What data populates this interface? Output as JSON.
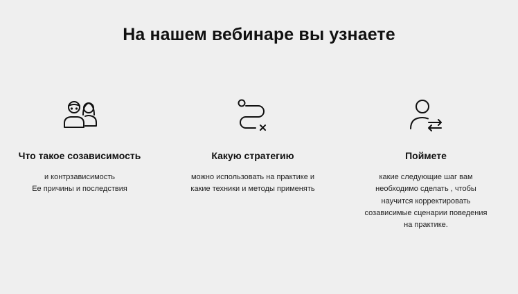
{
  "title": "На нашем вебинаре вы узнаете",
  "features": [
    {
      "icon": "people-icon",
      "heading": "Что такое созависимость",
      "lines": [
        "и контрзависимость",
        "Ее причины и последствия"
      ]
    },
    {
      "icon": "path-icon",
      "heading": "Какую стратегию",
      "lines": [
        "можно использовать на практике и",
        "какие техники и методы применять"
      ]
    },
    {
      "icon": "user-exchange-icon",
      "heading": "Поймете",
      "lines": [
        "какие следующие шаг вам",
        "необходимо сделать , чтобы",
        "научится корректировать",
        "созависимые сценарии поведения",
        "на практике."
      ]
    }
  ]
}
